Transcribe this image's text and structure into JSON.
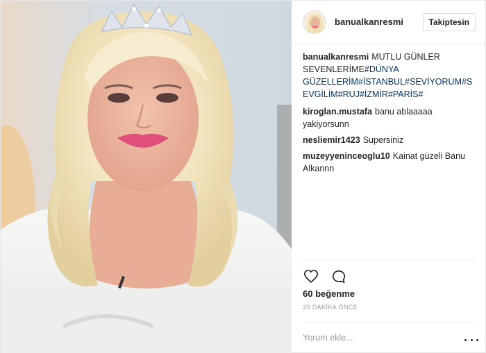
{
  "post": {
    "username": "banualkanresmi",
    "follow_label": "Takiptesin",
    "caption": {
      "username": "banualkanresmi",
      "text": "MUTLU GÜNLER SEVENLERİME",
      "hashtags": "#DÜNYA GÜZELLERİM#İSTANBUL#SEVİYORUM#SEVGİLİM#RUJ#İZMİR#PARİS#"
    },
    "comments": [
      {
        "username": "kiroglan.mustafa",
        "text": "banu ablaaaaa yakiyorsunn"
      },
      {
        "username": "nesliemir1423",
        "text": "Supersiniz"
      },
      {
        "username": "muzeyyeninceoglu10",
        "text": "Kainat güzeli Banu Alkannn"
      }
    ],
    "likes": "60 beğenme",
    "time": "20 DAKİKA ÖNCE",
    "comment_placeholder": "Yorum ekle..."
  },
  "icons": {
    "like": "heart-icon",
    "comment": "comment-icon",
    "more": "more-options-icon"
  },
  "colors": {
    "hashtag": "#003569",
    "muted": "#999999",
    "text": "#262626",
    "border": "#efefef"
  }
}
